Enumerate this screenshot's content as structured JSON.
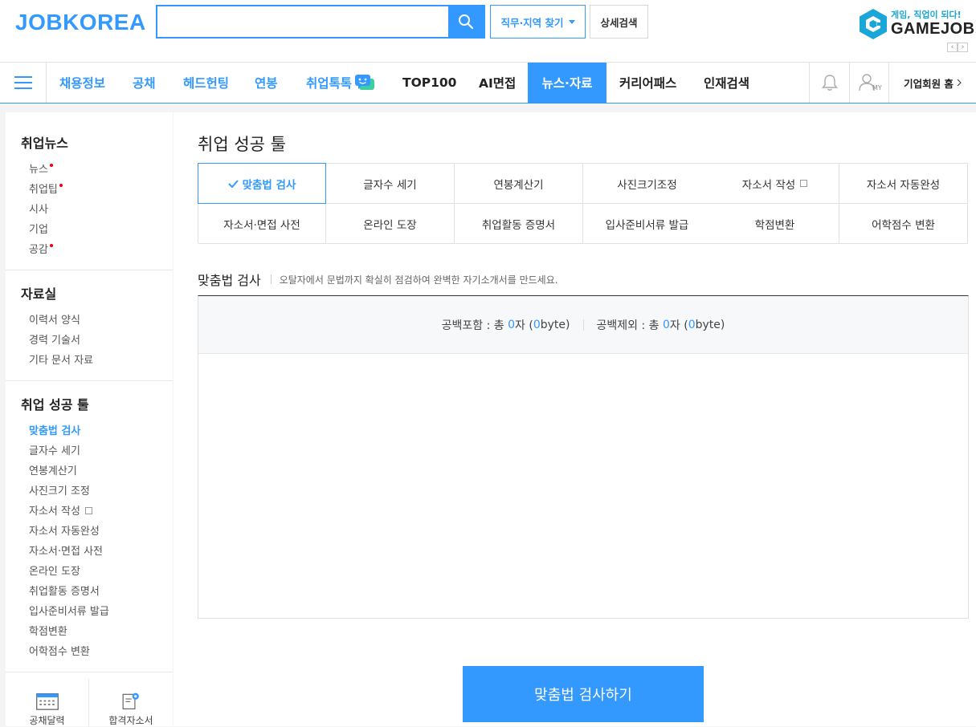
{
  "header": {
    "logo": "JOBKOREA",
    "search_value": "",
    "job_area_label": "직무·지역 찾기",
    "detail_search_label": "상세검색",
    "gamejob": {
      "tagline": "게임, 직업이 되다!",
      "name": "GAMEJOB",
      "prev": "‹",
      "next": "›"
    }
  },
  "nav": {
    "items": [
      {
        "label": "채용정보"
      },
      {
        "label": "공채"
      },
      {
        "label": "헤드헌팅"
      },
      {
        "label": "연봉"
      },
      {
        "label": "취업톡톡"
      },
      {
        "label": "TOP100"
      },
      {
        "label": "AI면접"
      },
      {
        "label": "뉴스·자료"
      },
      {
        "label": "커리어패스"
      },
      {
        "label": "인재검색"
      }
    ],
    "active_index": 7,
    "my_label": "MY",
    "corp_home": "기업회원 홈"
  },
  "sidebar": {
    "sections": [
      {
        "title": "취업뉴스",
        "items": [
          "뉴스",
          "취업팁",
          "시사",
          "기업",
          "공감"
        ]
      },
      {
        "title": "자료실",
        "items": [
          "이력서 양식",
          "경력 기술서",
          "기타 문서 자료"
        ]
      },
      {
        "title": "취업 성공 툴",
        "items": [
          "맞춤법 검사",
          "글자수 세기",
          "연봉계산기",
          "사진크기 조정",
          "자소서 작성",
          "자소서 자동완성",
          "자소서·면접 사전",
          "온라인 도장",
          "취업활동 증명서",
          "입사준비서류 발급",
          "학점변환",
          "어학점수 변환"
        ]
      }
    ],
    "shortcuts": [
      "공채달력",
      "합격자소서"
    ]
  },
  "main": {
    "title": "취업 성공 툴",
    "tools": [
      "맞춤법 검사",
      "글자수 세기",
      "연봉계산기",
      "사진크기조정",
      "자소서 작성",
      "자소서 자동완성",
      "자소서·면접 사전",
      "온라인 도장",
      "취업활동 증명서",
      "입사준비서류 발급",
      "학점변환",
      "어학점수 변환"
    ],
    "active_tool": 0,
    "section_title": "맞춤법 검사",
    "section_desc": "오탈자에서 문법까지 확실히 점검하여 완벽한 자기소개서를 만드세요.",
    "counter": {
      "with_space_label": "공백포함",
      "without_space_label": "공백제외",
      "prefix": " : 총 ",
      "chars": "0",
      "char_unit": "자 (",
      "bytes": "0",
      "byte_unit": "byte)"
    },
    "textarea_value": "",
    "submit_label": "맞춤법 검사하기"
  }
}
